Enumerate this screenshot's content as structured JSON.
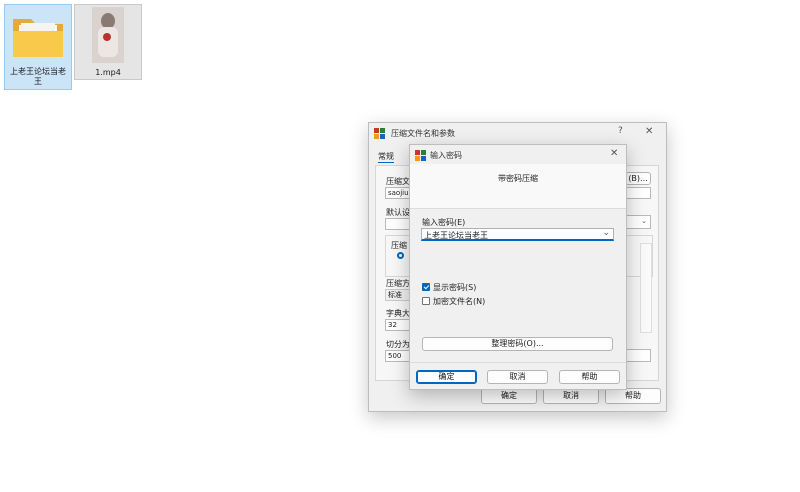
{
  "desktop": {
    "items": [
      {
        "label": "上老王论坛当老王",
        "icon": "folder-icon"
      },
      {
        "label": "1.mp4",
        "icon": "video-thumbnail"
      }
    ]
  },
  "archive_dialog": {
    "title": "压缩文件名和参数",
    "help_glyph": "?",
    "close_glyph": "✕",
    "tab_general": "常规",
    "archive_name_label": "压缩文",
    "archive_name_value": "saojiu",
    "browse_label": "(B)...",
    "default_label": "默认设",
    "format_label": "压缩",
    "method_label": "压缩方",
    "method_value": "标准",
    "dict_label": "字典大",
    "dict_value": "32",
    "split_label": "切分为",
    "split_value": "500",
    "ok": "确定",
    "cancel": "取消",
    "help": "帮助"
  },
  "password_dialog": {
    "title": "输入密码",
    "close_glyph": "✕",
    "heading": "带密码压缩",
    "enter_label": "输入密码(E)",
    "password_value": "上老王论坛当老王",
    "show_password": "显示密码(S)",
    "show_password_checked": true,
    "encrypt_names": "加密文件名(N)",
    "encrypt_names_checked": false,
    "organize": "整理密码(O)...",
    "ok": "确定",
    "cancel": "取消",
    "help": "帮助"
  },
  "colors": {
    "accent": "#0067c0",
    "folder": "#f5c542",
    "selection": "#cce4f7"
  }
}
